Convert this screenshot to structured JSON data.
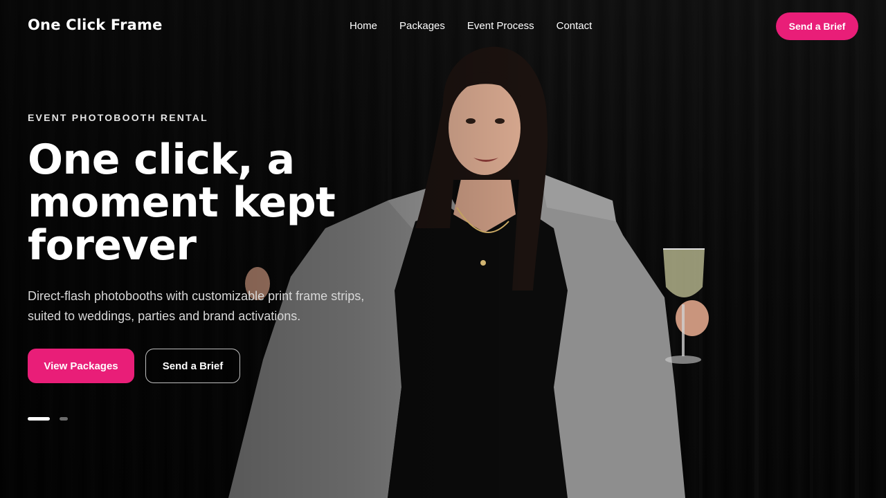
{
  "header": {
    "logo": "One Click Frame",
    "nav": [
      {
        "label": "Home"
      },
      {
        "label": "Packages"
      },
      {
        "label": "Event Process"
      },
      {
        "label": "Contact"
      }
    ],
    "cta_label": "Send a Brief"
  },
  "hero": {
    "eyebrow": "EVENT PHOTOBOOTH RENTAL",
    "headline_lines": [
      "One click, a",
      "moment kept",
      "forever"
    ],
    "description": "Direct-flash photobooths with customizable print frame strips, suited to weddings, parties and brand activations.",
    "primary_button": "View Packages",
    "secondary_button": "Send a Brief",
    "slider": {
      "current": 1,
      "total": 2
    }
  },
  "colors": {
    "accent": "#e91e78",
    "background": "#070707",
    "text": "#ffffff"
  }
}
